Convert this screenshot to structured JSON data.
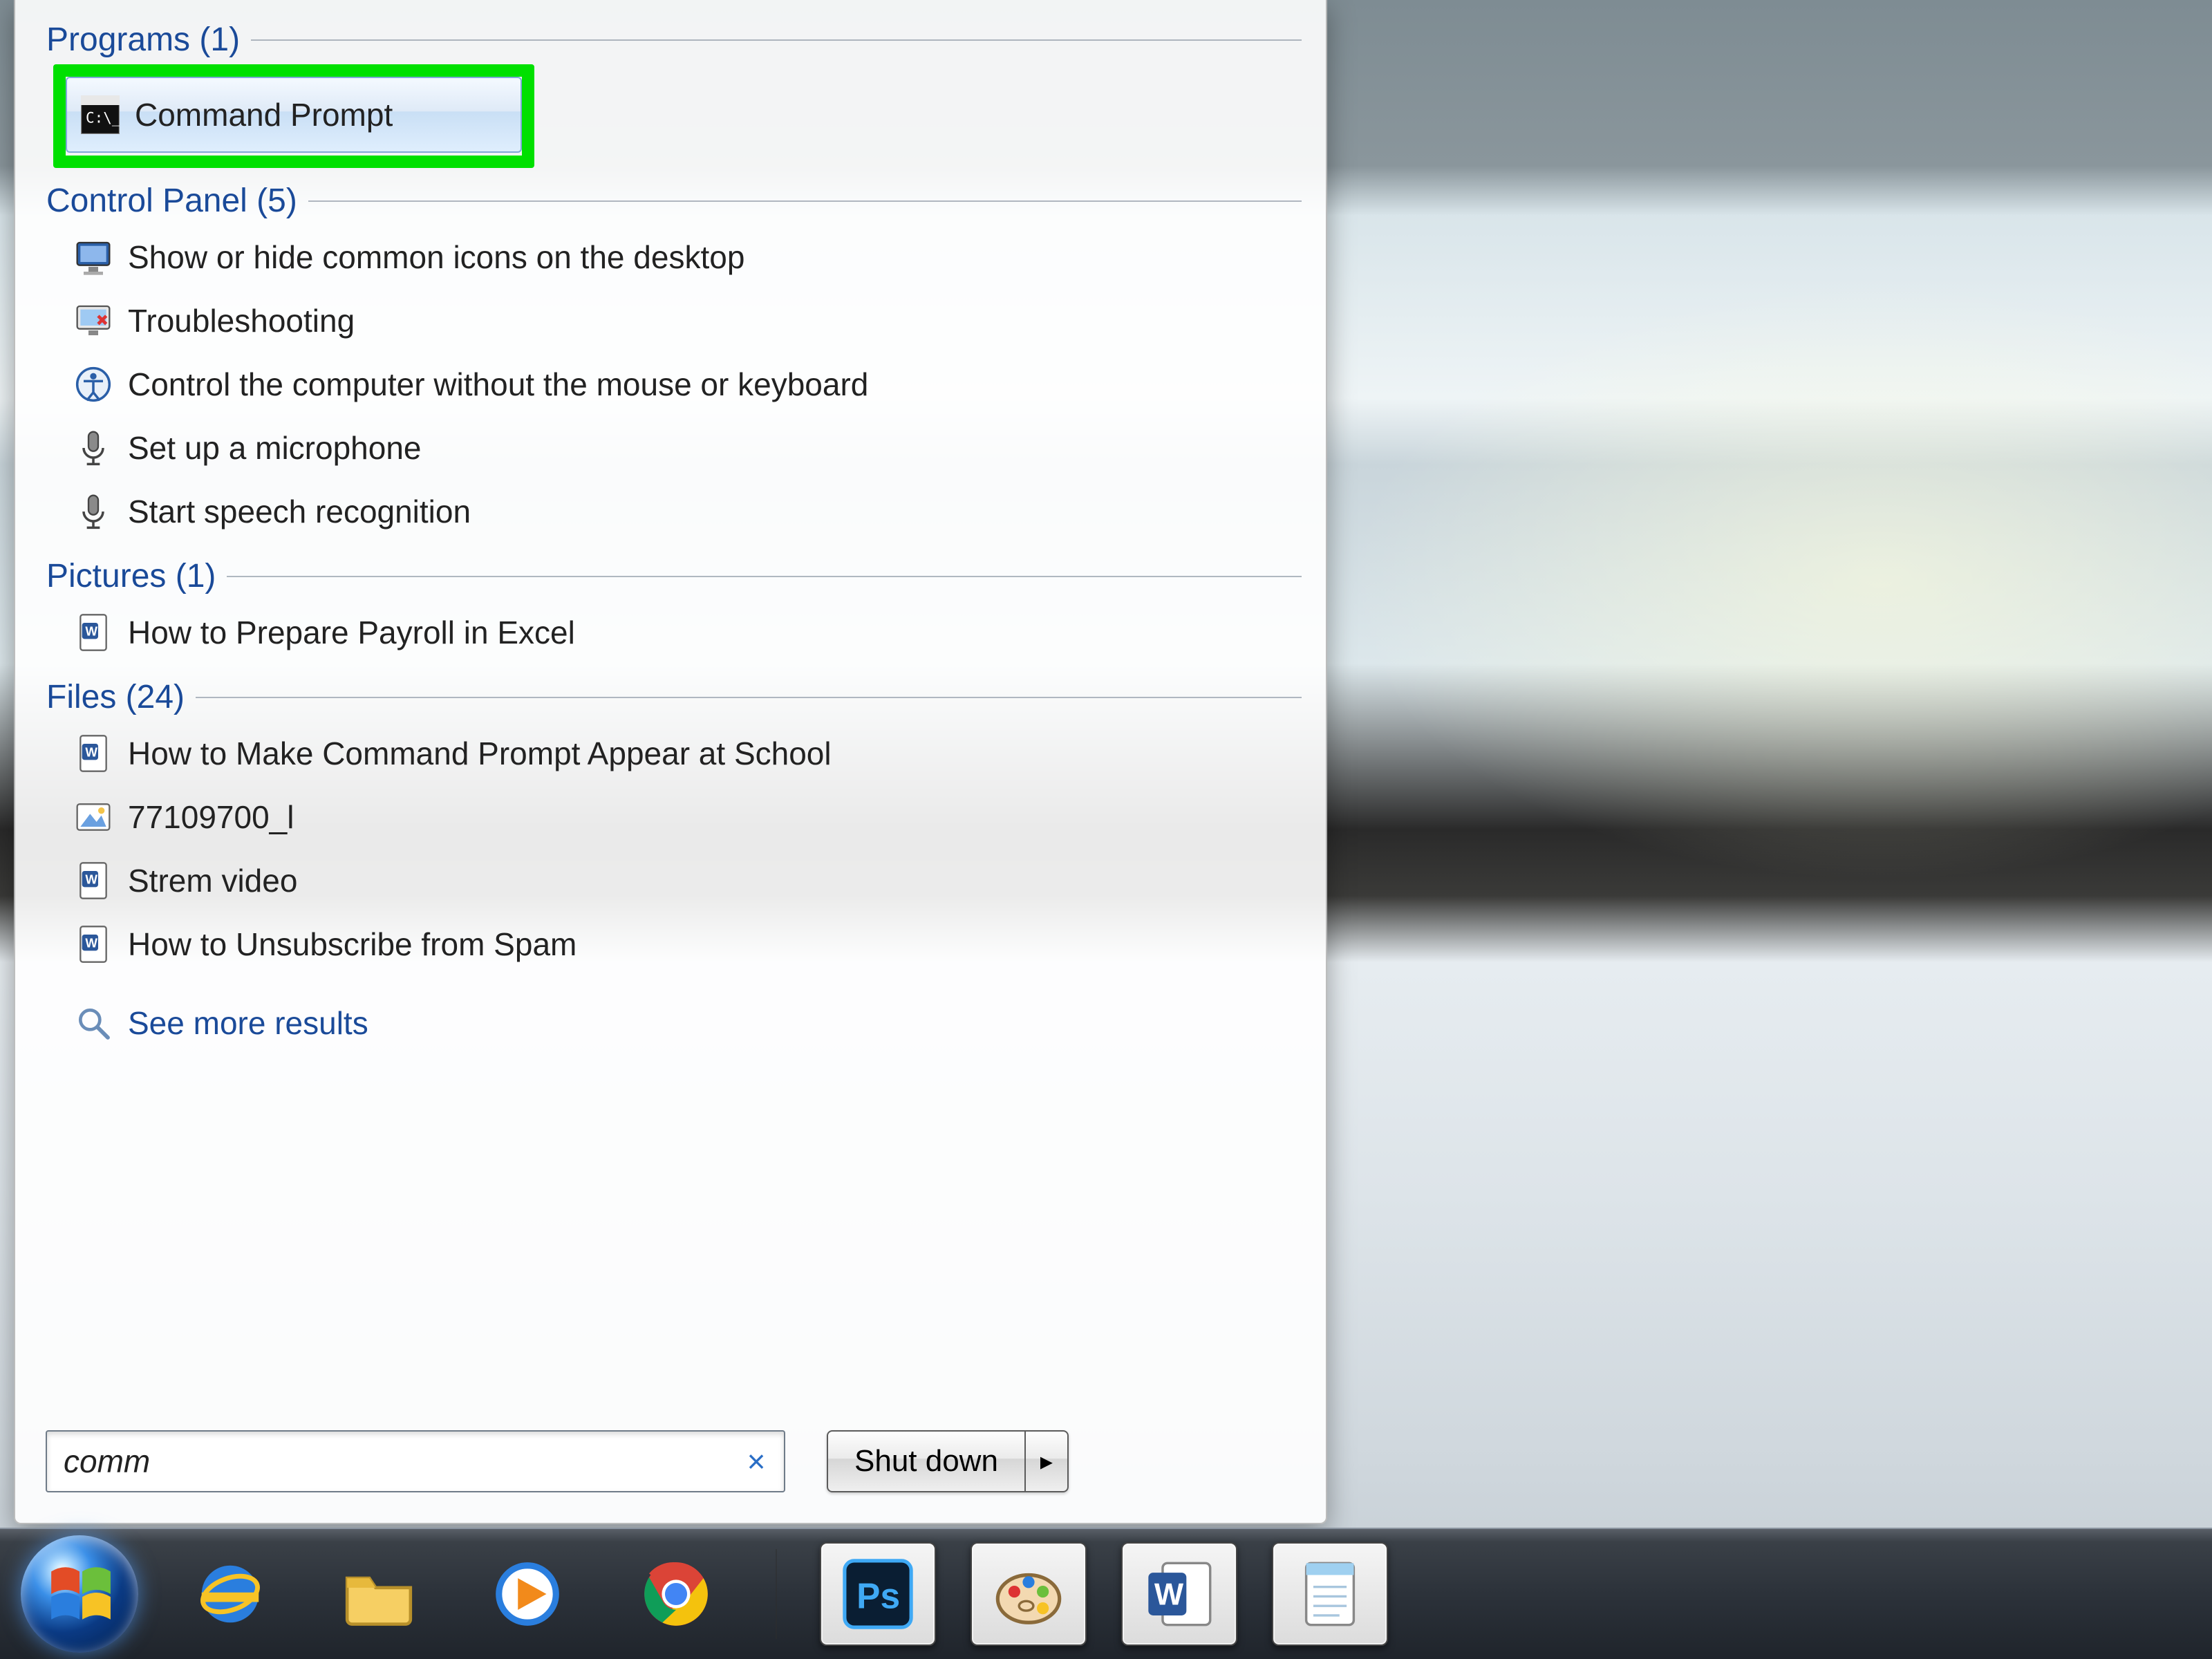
{
  "categories": {
    "programs": {
      "title": "Programs (1)"
    },
    "control_panel": {
      "title": "Control Panel (5)"
    },
    "pictures": {
      "title": "Pictures (1)"
    },
    "files": {
      "title": "Files (24)"
    }
  },
  "programs": {
    "items": [
      {
        "label": "Command Prompt"
      }
    ]
  },
  "control_panel": {
    "items": [
      {
        "label": "Show or hide common icons on the desktop"
      },
      {
        "label": "Troubleshooting"
      },
      {
        "label": "Control the computer without the mouse or keyboard"
      },
      {
        "label": "Set up a microphone"
      },
      {
        "label": "Start speech recognition"
      }
    ]
  },
  "pictures": {
    "items": [
      {
        "label": "How to Prepare Payroll in Excel"
      }
    ]
  },
  "files": {
    "items": [
      {
        "label": "How to Make Command Prompt Appear at School"
      },
      {
        "label": "77109700_l"
      },
      {
        "label": "Strem video"
      },
      {
        "label": "How to Unsubscribe from Spam"
      }
    ]
  },
  "see_more": {
    "label": "See more results"
  },
  "search": {
    "value": "comm"
  },
  "shutdown": {
    "label": "Shut down"
  },
  "taskbar": {
    "items": [
      {
        "name": "start-button"
      },
      {
        "name": "ie-button"
      },
      {
        "name": "explorer-button"
      },
      {
        "name": "media-player-button"
      },
      {
        "name": "chrome-button"
      },
      {
        "name": "photoshop-button"
      },
      {
        "name": "paint-button"
      },
      {
        "name": "word-button"
      },
      {
        "name": "notepad-button"
      }
    ]
  }
}
